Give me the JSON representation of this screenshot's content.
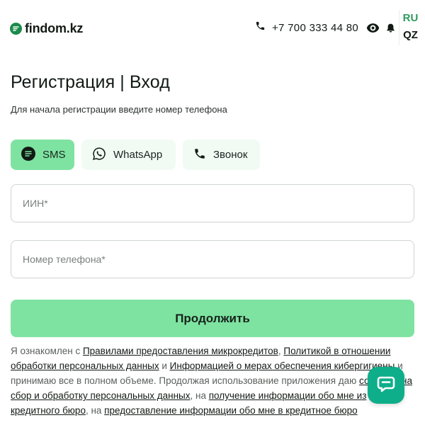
{
  "header": {
    "logo_text": "findom.kz",
    "phone": "+7 700 333 44 80",
    "lang_ru": "RU",
    "lang_qz": "QZ",
    "icons": [
      "logo-icon",
      "phone-icon",
      "eye-icon",
      "bell-icon"
    ]
  },
  "main": {
    "title": "Регистрация | Вход",
    "subtitle": "Для начала регистрации введите номер телефона",
    "methods": [
      {
        "label": "SMS",
        "icon": "sms-icon",
        "active": true
      },
      {
        "label": "WhatsApp",
        "icon": "whatsapp-icon",
        "active": false
      },
      {
        "label": "Звонок",
        "icon": "phone-icon",
        "active": false
      }
    ],
    "iin_placeholder": "ИИН*",
    "phone_placeholder": "Номер телефона*",
    "continue_label": "Продолжить"
  },
  "legal": {
    "t1": "Я ознакомлен с ",
    "l1": "Правилами предоставления микрокредитов",
    "t2": ", ",
    "l2": "Политикой в отношении обработки персональных данных",
    "t3": " и ",
    "l3": "Информацией о мерах обеспечения кибергигиены",
    "t4": " и принимаю все в полном объеме. Продолжая использование приложения даю ",
    "l4": "согласие на сбор и обработку персональных данных",
    "t5": ", на ",
    "l5": "получение информации обо мне из кредитного бюро",
    "t6": ", на ",
    "l6": "предоставление информации обо мне в кредитное бюро"
  },
  "colors": {
    "accent": "#7ee3a1",
    "accent_light": "#f1fbf4",
    "brand_green": "#2f9a5b",
    "chat_fab": "#0fae8a"
  },
  "chat_icon": "chat-icon"
}
